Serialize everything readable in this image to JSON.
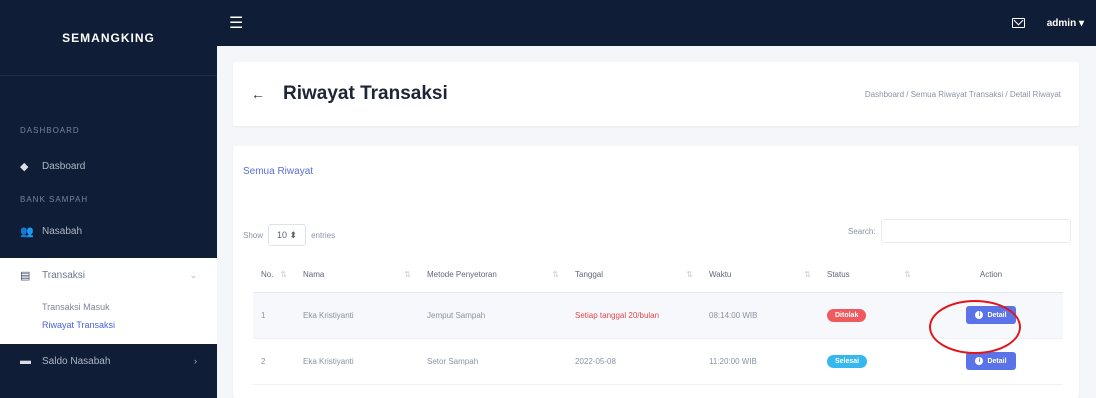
{
  "sidebar": {
    "brand": "SEMANGKING",
    "sections": [
      {
        "label": "DASHBOARD"
      },
      {
        "label": "BANK SAMPAH"
      }
    ],
    "items": [
      {
        "label": "Dasboard",
        "icon": "home-icon"
      },
      {
        "label": "Nasabah",
        "icon": "users-icon"
      },
      {
        "label": "Transaksi",
        "icon": "document-icon"
      },
      {
        "label": "Saldo Nasabah",
        "icon": "wallet-icon"
      }
    ],
    "submenu": [
      {
        "label": "Transaksi Masuk"
      },
      {
        "label": "Riwayat Transaksi"
      }
    ]
  },
  "topbar": {
    "menu_icon": "hamburger-icon",
    "mail_icon": "mail-icon",
    "user": "admin ▾"
  },
  "page": {
    "title": "Riwayat Transaksi",
    "breadcrumb": "Dashboard / Semua Riwayat Transaksi / Detail Riwayat"
  },
  "card": {
    "title": "Semua Riwayat",
    "show_label": "Show",
    "entries_value": "10 ⬍",
    "entries_label": "entries",
    "search_label": "Search:"
  },
  "table": {
    "headers": [
      "No.",
      "Nama",
      "Metode Penyetoran",
      "Tanggal",
      "Waktu",
      "Status",
      "Action"
    ],
    "rows": [
      {
        "no": "1",
        "nama": "Eka Kristiyanti",
        "metode": "Jemput Sampah",
        "tanggal": "Setiap tanggal 20/bulan",
        "waktu": "08:14:00 WIB",
        "status": "Ditolak",
        "action": "Detail"
      },
      {
        "no": "2",
        "nama": "Eka Kristiyanti",
        "metode": "Setor Sampah",
        "tanggal": "2022-05-08",
        "waktu": "11:20:00 WIB",
        "status": "Selesai",
        "action": "Detail"
      }
    ]
  },
  "colors": {
    "sidebar_bg": "#0f1d36",
    "accent": "#5b73e8",
    "status_rejected": "#f05a5e",
    "status_done": "#36b7ee",
    "highlight": "#e0161d"
  }
}
